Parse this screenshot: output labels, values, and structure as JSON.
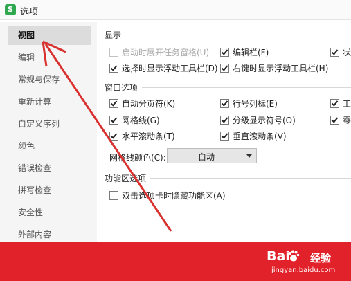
{
  "window": {
    "title": "选项",
    "app_icon_letter": "S",
    "app_color": "#2fa84f"
  },
  "sidebar": {
    "items": [
      {
        "label": "视图",
        "active": true
      },
      {
        "label": "编辑"
      },
      {
        "label": "常规与保存"
      },
      {
        "label": "重新计算"
      },
      {
        "label": "自定义序列"
      },
      {
        "label": "颜色"
      },
      {
        "label": "错误检查"
      },
      {
        "label": "拼写检查"
      },
      {
        "label": "安全性"
      },
      {
        "label": "外部内容"
      }
    ]
  },
  "sections": {
    "display": {
      "title": "显示",
      "options": [
        {
          "label": "启动时展开任务窗格(U)",
          "checked": false,
          "disabled": true
        },
        {
          "label": "编辑栏(F)",
          "checked": true
        },
        {
          "label": "状",
          "checked": true
        },
        {
          "label": "选择时显示浮动工具栏(D)",
          "checked": true
        },
        {
          "label": "右键时显示浮动工具栏(H)",
          "checked": true
        }
      ]
    },
    "window": {
      "title": "窗口选项",
      "options": [
        {
          "label": "自动分页符(K)",
          "checked": true
        },
        {
          "label": "行号列标(E)",
          "checked": true
        },
        {
          "label": "工",
          "checked": true
        },
        {
          "label": "网格线(G)",
          "checked": true
        },
        {
          "label": "分级显示符号(O)",
          "checked": true
        },
        {
          "label": "零",
          "checked": true
        },
        {
          "label": "水平滚动条(T)",
          "checked": true
        },
        {
          "label": "垂直滚动条(V)",
          "checked": true
        }
      ],
      "gridline_color_label": "网格线颜色(C):",
      "gridline_color_value": "自动"
    },
    "ribbon": {
      "title": "功能区选项",
      "options": [
        {
          "label": "双击选项卡时隐藏功能区(A)",
          "checked": false
        }
      ]
    }
  },
  "watermark": {
    "logo_text": "Bai",
    "logo_suffix": "经验",
    "url": "jingyan.baidu.com",
    "color": "#e2222b"
  },
  "annotation": {
    "arrow_color": "#d9312f"
  }
}
